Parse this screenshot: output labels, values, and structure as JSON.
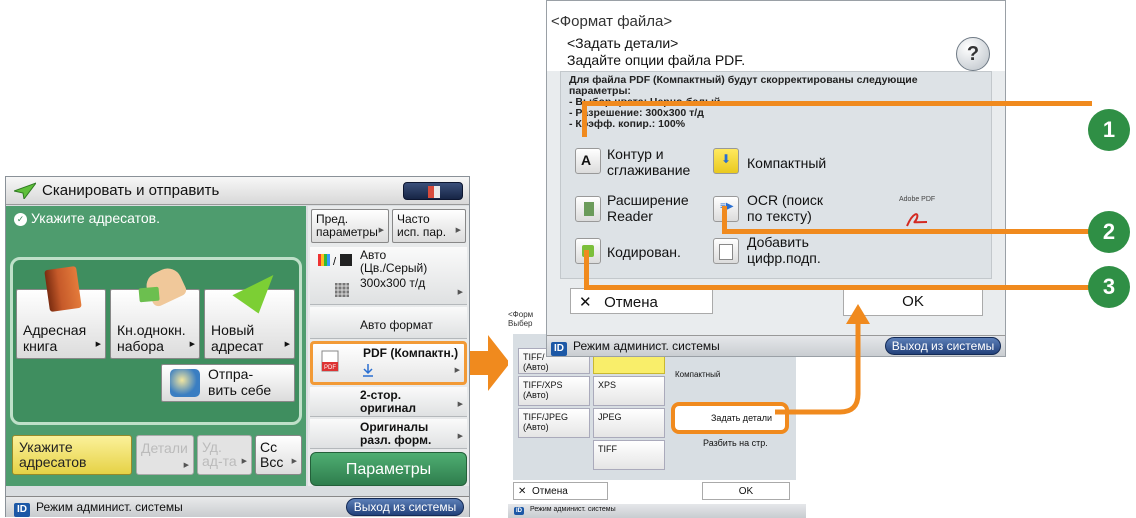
{
  "left": {
    "title": "Сканировать и отправить",
    "hint": "Укажите адресатов.",
    "tiles": {
      "address_book": [
        "Адресная",
        "книга"
      ],
      "one_touch": [
        "Кн.однокн.",
        "набора"
      ],
      "new_dest": [
        "Новый",
        "адресат"
      ],
      "send_self": [
        "Отпра-",
        "вить себе"
      ]
    },
    "tabs": {
      "specify": [
        "Укажите",
        "адресатов"
      ],
      "details": "Детали",
      "delete": [
        "Уд.",
        "ад-та"
      ],
      "cc": [
        "Cc",
        "Bcc"
      ]
    },
    "right": {
      "preset": [
        "Пред.",
        "параметры"
      ],
      "frequent": [
        "Часто",
        "исп. пар."
      ],
      "color": [
        "Авто",
        "(Цв./Серый)"
      ],
      "resolution": "300x300 т/д",
      "size": "Авто формат",
      "format": "PDF (Компактн.)",
      "duplex": [
        "2-стор.",
        "оригинал"
      ],
      "mixed": [
        "Оригиналы",
        "разл. форм."
      ],
      "params": "Параметры"
    },
    "status": "Режим админист. системы",
    "logout": "Выход из системы"
  },
  "mid": {
    "frag": [
      "<Форм",
      "Выбер"
    ],
    "header": "Режим админист. системы",
    "logout": "Выход из системы",
    "tiles": {
      "tiff": [
        "TIFF/",
        "(Авто)"
      ],
      "tiff_xps": [
        "TIFF/XPS",
        "(Авто)"
      ],
      "xps": "XPS",
      "tiff_jpeg": [
        "TIFF/JPEG",
        "(Авто)"
      ],
      "jpeg": "JPEG",
      "tiff2": "TIFF",
      "compact": "Компактный",
      "set_details": "Задать детали",
      "split": "Разбить на стр."
    },
    "cancel": "Отмена",
    "ok": "OK",
    "status": "Режим админист. системы",
    "logout2": "Выход из системы"
  },
  "zoom": {
    "head0": "<Формат файла>",
    "head1": "<Задать детали>",
    "head2": "Задайте опции файла PDF.",
    "note": [
      "Для файла PDF (Компактный) будут скорректированы следующие",
      "параметры:",
      "- Выбор цвета: Черно-белый ... ",
      "- Разрешение: 300x300 т/д",
      "- Коэфф. копир.: 100%"
    ],
    "buttons": {
      "outline": [
        "Контур и",
        "сглаживание"
      ],
      "compact": "Компактный",
      "reader": [
        "Расширение",
        "Reader"
      ],
      "ocr": [
        "OCR (поиск",
        "по тексту)"
      ],
      "encrypt": "Кодирован.",
      "sign": [
        "Добавить",
        "цифр.подп."
      ]
    },
    "adobe": "Adobe PDF",
    "cancel": "Отмена",
    "ok": "OK"
  },
  "callouts": [
    "1",
    "2",
    "3"
  ],
  "colors": {
    "green": "#4e9c6e",
    "orange": "#f08a1e",
    "callout": "#2f8f45"
  }
}
